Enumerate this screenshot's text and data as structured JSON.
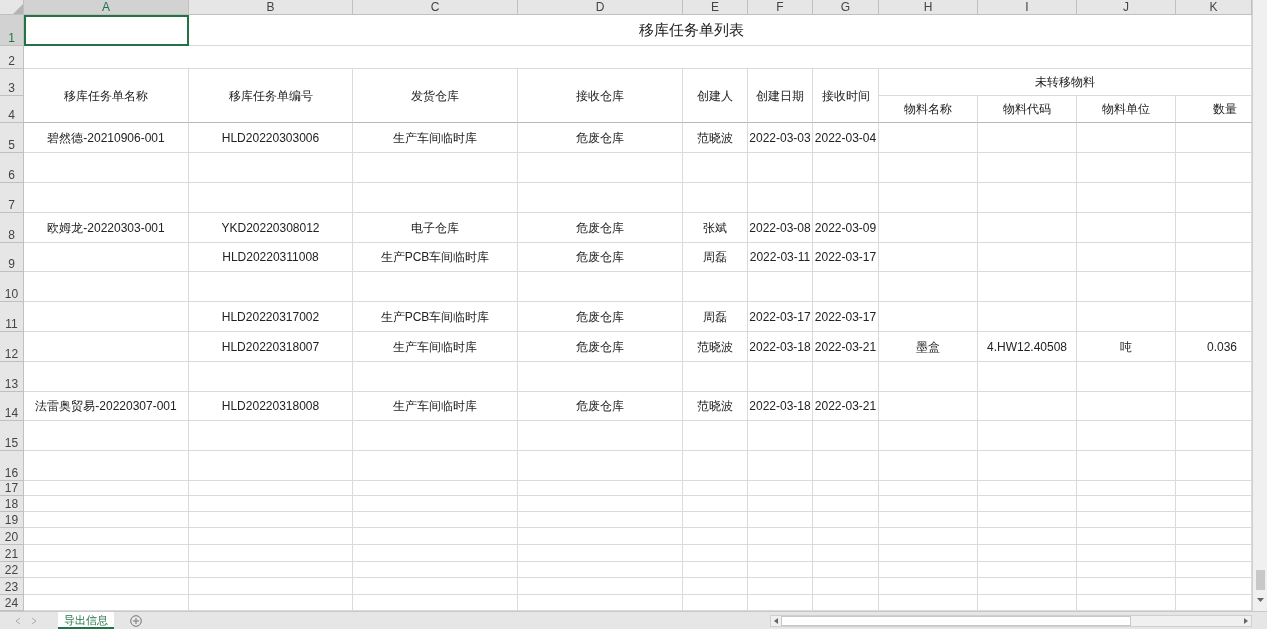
{
  "columns": [
    {
      "label": "A",
      "selected": true
    },
    {
      "label": "B",
      "selected": false
    },
    {
      "label": "C",
      "selected": false
    },
    {
      "label": "D",
      "selected": false
    },
    {
      "label": "E",
      "selected": false
    },
    {
      "label": "F",
      "selected": false
    },
    {
      "label": "G",
      "selected": false
    },
    {
      "label": "H",
      "selected": false
    },
    {
      "label": "I",
      "selected": false
    },
    {
      "label": "J",
      "selected": false
    },
    {
      "label": "K",
      "selected": false
    }
  ],
  "row_numbers": [
    {
      "label": "1",
      "selected": true
    },
    {
      "label": "2",
      "selected": false
    },
    {
      "label": "3",
      "selected": false
    },
    {
      "label": "4",
      "selected": false
    },
    {
      "label": "5",
      "selected": false
    },
    {
      "label": "6",
      "selected": false
    },
    {
      "label": "7",
      "selected": false
    },
    {
      "label": "8",
      "selected": false
    },
    {
      "label": "9",
      "selected": false
    },
    {
      "label": "10",
      "selected": false
    },
    {
      "label": "11",
      "selected": false
    },
    {
      "label": "12",
      "selected": false
    },
    {
      "label": "13",
      "selected": false
    },
    {
      "label": "14",
      "selected": false
    },
    {
      "label": "15",
      "selected": false
    },
    {
      "label": "16",
      "selected": false
    },
    {
      "label": "17",
      "selected": false
    },
    {
      "label": "18",
      "selected": false
    },
    {
      "label": "19",
      "selected": false
    },
    {
      "label": "20",
      "selected": false
    },
    {
      "label": "21",
      "selected": false
    },
    {
      "label": "22",
      "selected": false
    },
    {
      "label": "23",
      "selected": false
    },
    {
      "label": "24",
      "selected": false
    }
  ],
  "title": "移库任务单列表",
  "headers": [
    "移库任务单名称",
    "移库任务单编号",
    "发货仓库",
    "接收仓库",
    "创建人",
    "创建日期",
    "接收时间"
  ],
  "group_header": "未转移物料",
  "sub_headers": [
    "物料名称",
    "物料代码",
    "物料单位",
    "数量"
  ],
  "data_rows": [
    {
      "cells": [
        "碧然德-20210906-001",
        "HLD20220303006",
        "生产车间临时库",
        "危废仓库",
        "范晓波",
        "2022-03-03",
        "2022-03-04"
      ]
    },
    {
      "cells": []
    },
    {
      "cells": []
    },
    {
      "cells": [
        "欧姆龙-20220303-001",
        "YKD20220308012",
        "电子仓库",
        "危废仓库",
        "张斌",
        "2022-03-08",
        "2022-03-09"
      ]
    },
    {
      "cells": [
        null,
        "HLD20220311008",
        "生产PCB车间临时库",
        "危废仓库",
        "周磊",
        "2022-03-11",
        "2022-03-17"
      ]
    },
    {
      "cells": []
    },
    {
      "cells": [
        null,
        "HLD20220317002",
        "生产PCB车间临时库",
        "危废仓库",
        "周磊",
        "2022-03-17",
        "2022-03-17"
      ]
    },
    {
      "cells": [
        null,
        "HLD20220318007",
        "生产车间临时库",
        "危废仓库",
        "范晓波",
        "2022-03-18",
        "2022-03-21",
        "墨盒",
        "4.HW12.40508",
        "吨",
        "0.036"
      ]
    },
    {
      "cells": []
    },
    {
      "cells": [
        "法雷奥贸易-20220307-001",
        "HLD20220318008",
        "生产车间临时库",
        "危废仓库",
        "范晓波",
        "2022-03-18",
        "2022-03-21"
      ]
    }
  ],
  "sheet_tabs": [
    {
      "label": "导出信息",
      "selected": true
    }
  ]
}
